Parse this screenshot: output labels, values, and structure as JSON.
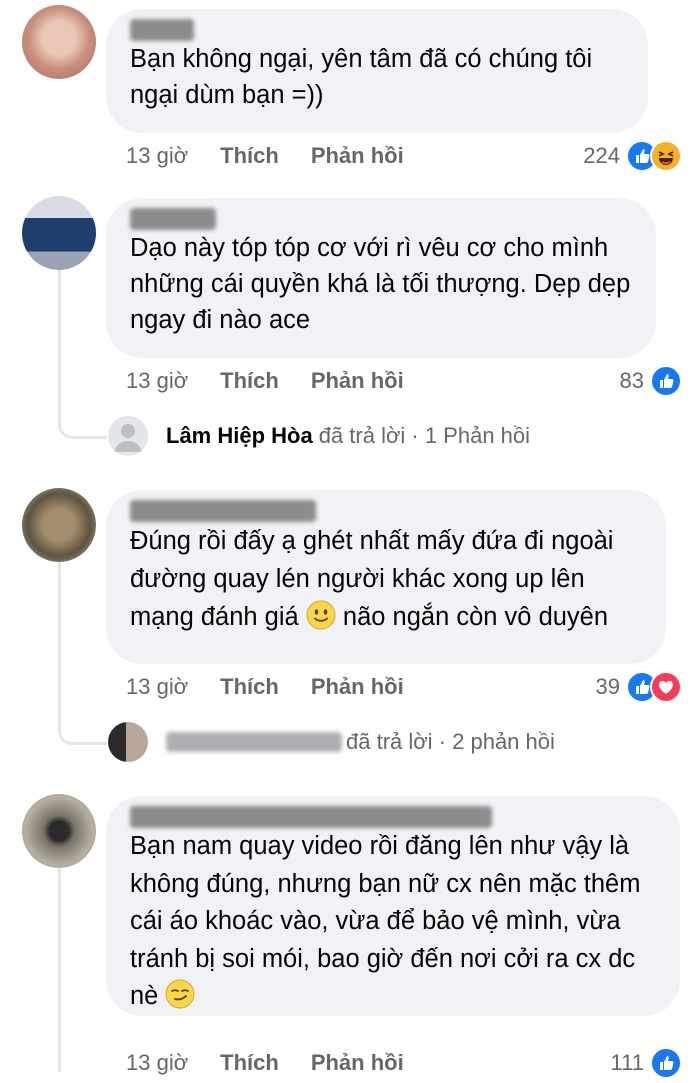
{
  "comments": [
    {
      "text": "Bạn không ngại, yên tâm đã có chúng tôi ngại dùm bạn =))",
      "time": "13 giờ",
      "like": "Thích",
      "reply": "Phản hồi",
      "reactions": "224"
    },
    {
      "text": "Dạo này tóp tóp cơ với rì vêu cơ cho mình những cái quyền khá là tối thượng. Dẹp dẹp ngay đi nào ace",
      "time": "13 giờ",
      "like": "Thích",
      "reply": "Phản hồi",
      "reactions": "83",
      "reply_summary": {
        "name": "Lâm Hiệp Hòa",
        "rest": "đã trả lời · 1 Phản hồi"
      }
    },
    {
      "text_a": "Đúng rồi đấy ạ ghét nhất mấy đứa đi ngoài đường quay lén người khác xong up lên mạng đánh giá",
      "text_b": "não ngắn còn vô duyên",
      "time": "13 giờ",
      "like": "Thích",
      "reply": "Phản hồi",
      "reactions": "39",
      "reply_summary": {
        "rest": "đã trả lời · 2 phản hồi"
      }
    },
    {
      "text_a": "Bạn nam quay video rồi đăng lên như vậy là không đúng, nhưng bạn nữ cx nên mặc thêm cái áo khoác vào, vừa để bảo vệ mình, vừa tránh bị soi mói, bao giờ đến nơi cởi ra cx dc nè",
      "time": "13 giờ",
      "like": "Thích",
      "reply": "Phản hồi",
      "reactions": "111"
    }
  ],
  "icons": {
    "like": "like-reaction-icon",
    "love": "love-reaction-icon",
    "haha": "haha-reaction-icon"
  },
  "colors": {
    "bubble": "#f0f2f5",
    "meta": "#65676b",
    "like": "#1877f2",
    "love": "#f33e58",
    "haha": "#f7b125"
  }
}
